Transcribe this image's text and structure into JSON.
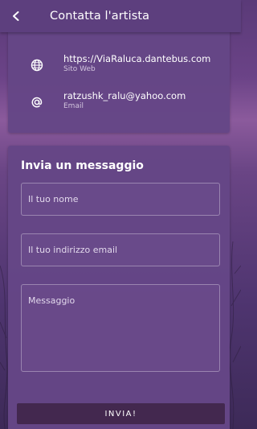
{
  "appbar": {
    "title": "Contatta l'artista",
    "back_icon": "arrow-left-icon"
  },
  "contacts": [
    {
      "icon": "globe-icon",
      "value": "https://ViaRaluca.dantebus.com",
      "label": "Sito Web"
    },
    {
      "icon": "at-sign-icon",
      "value": "ratzushk_ralu@yahoo.com",
      "label": "Email"
    }
  ],
  "form": {
    "title": "Invia un messaggio",
    "name_placeholder": "Il tuo nome",
    "email_placeholder": "Il tuo indirizzo email",
    "message_placeholder": "Messaggio",
    "send_label": "INVIA!"
  },
  "colors": {
    "appbar": "#5d3f7e",
    "card": "#654686",
    "button": "#43284f"
  }
}
